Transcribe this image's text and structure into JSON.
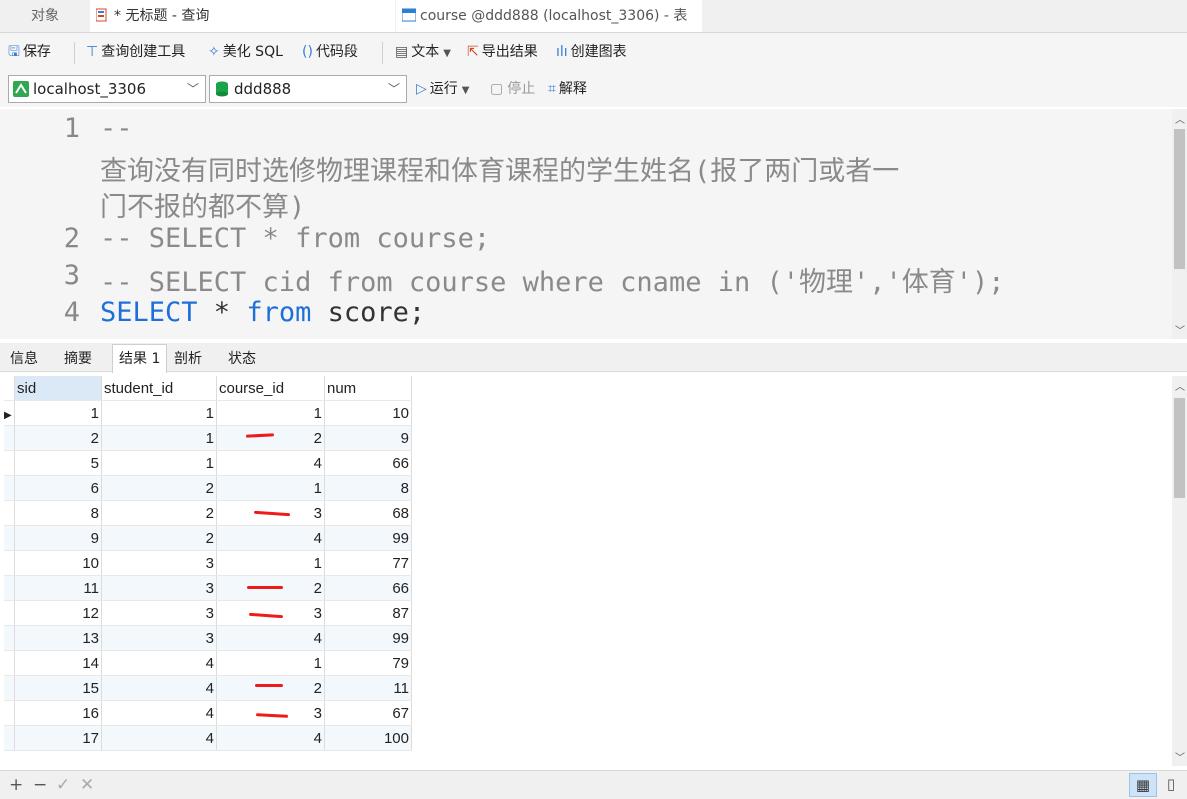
{
  "tabs": {
    "objects": "对象",
    "query": "* 无标题 - 查询",
    "course": "course @ddd888 (localhost_3306) - 表"
  },
  "toolbar": {
    "save": "保存",
    "query_builder": "查询创建工具",
    "beautify": "美化 SQL",
    "snippet": "代码段",
    "text": "文本",
    "export": "导出结果",
    "create_chart": "创建图表"
  },
  "connection": {
    "server": "localhost_3306",
    "database": "ddd888"
  },
  "run": {
    "run": "运行",
    "stop": "停止",
    "explain": "解释"
  },
  "editor": {
    "line_numbers": [
      "1",
      "2",
      "3",
      "4"
    ],
    "line1a": "--",
    "line1b": "查询没有同时选修物理课程和体育课程的学生姓名(报了两门或者一",
    "line1c": "门不报的都不算)",
    "line2": "-- SELECT * from course;",
    "line3": "-- SELECT cid from course where cname in ('物理','体育');",
    "line4_kw1": "SELECT",
    "line4_mid": " * ",
    "line4_kw2": "from",
    "line4_rest": " score;"
  },
  "result_tabs": [
    "信息",
    "摘要",
    "结果 1",
    "剖析",
    "状态"
  ],
  "table": {
    "columns": [
      "sid",
      "student_id",
      "course_id",
      "num"
    ],
    "rows": [
      [
        "1",
        "1",
        "1",
        "10"
      ],
      [
        "2",
        "1",
        "2",
        "9"
      ],
      [
        "5",
        "1",
        "4",
        "66"
      ],
      [
        "6",
        "2",
        "1",
        "8"
      ],
      [
        "8",
        "2",
        "3",
        "68"
      ],
      [
        "9",
        "2",
        "4",
        "99"
      ],
      [
        "10",
        "3",
        "1",
        "77"
      ],
      [
        "11",
        "3",
        "2",
        "66"
      ],
      [
        "12",
        "3",
        "3",
        "87"
      ],
      [
        "13",
        "3",
        "4",
        "99"
      ],
      [
        "14",
        "4",
        "1",
        "79"
      ],
      [
        "15",
        "4",
        "2",
        "11"
      ],
      [
        "16",
        "4",
        "3",
        "67"
      ],
      [
        "17",
        "4",
        "4",
        "100"
      ]
    ]
  },
  "statusbar": {
    "add": "+",
    "remove": "−",
    "apply": "✓",
    "discard": "✕"
  },
  "colors": {
    "keyword": "#1e6fd9",
    "comment": "#8a8a8a",
    "annotation": "#ee1b1b"
  }
}
